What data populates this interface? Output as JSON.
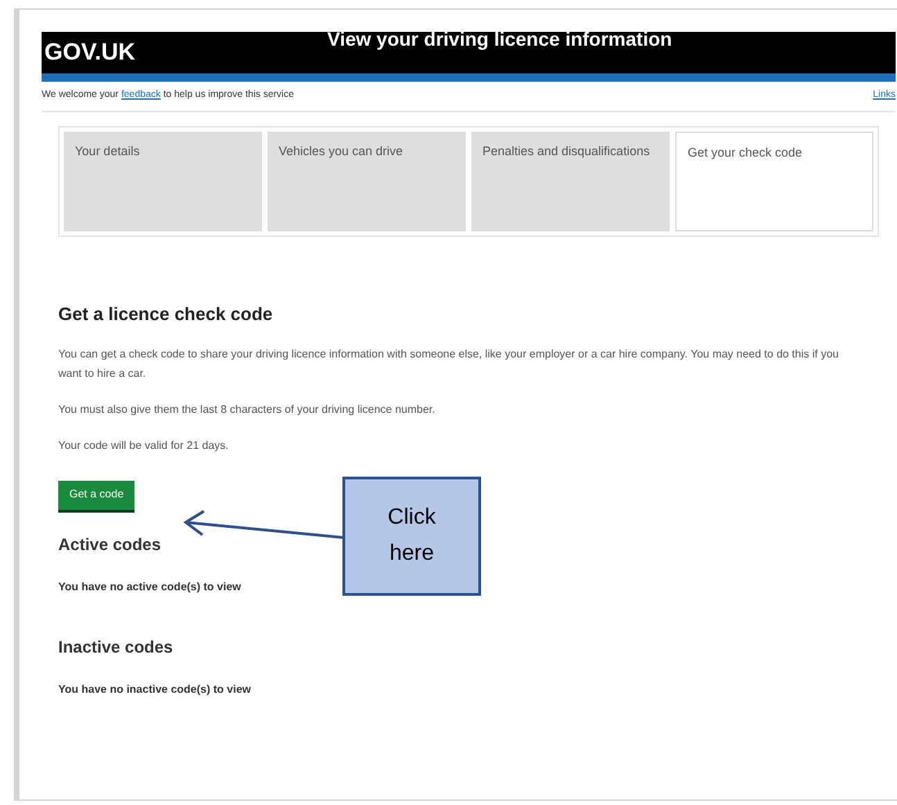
{
  "header": {
    "logo": "GOV.UK",
    "title": "View your driving licence information"
  },
  "feedback_bar": {
    "before": "We welcome your",
    "link": "feedback",
    "after": "to help us improve this service",
    "right_link": "Links"
  },
  "tabs": [
    {
      "label": "Your details",
      "selected": false
    },
    {
      "label": "Vehicles you can drive",
      "selected": false
    },
    {
      "label": "Penalties and disqualifications",
      "selected": false
    },
    {
      "label": "Get your check code",
      "selected": true
    }
  ],
  "main": {
    "heading": "Get a licence check code",
    "paragraphs": [
      "You can get a check code to share your driving licence information with someone else, like your employer or a car hire company. You may need to do this if you want to hire a car.",
      "You must also give them the last 8 characters of your driving licence number.",
      "Your code will be valid for 21 days."
    ],
    "button": "Get a code",
    "sections": [
      {
        "heading": "Active codes",
        "text": "You have no active code(s) to view"
      },
      {
        "heading": "Inactive codes",
        "text": "You have no inactive code(s) to view"
      }
    ]
  },
  "callout": {
    "text": "Click here"
  }
}
